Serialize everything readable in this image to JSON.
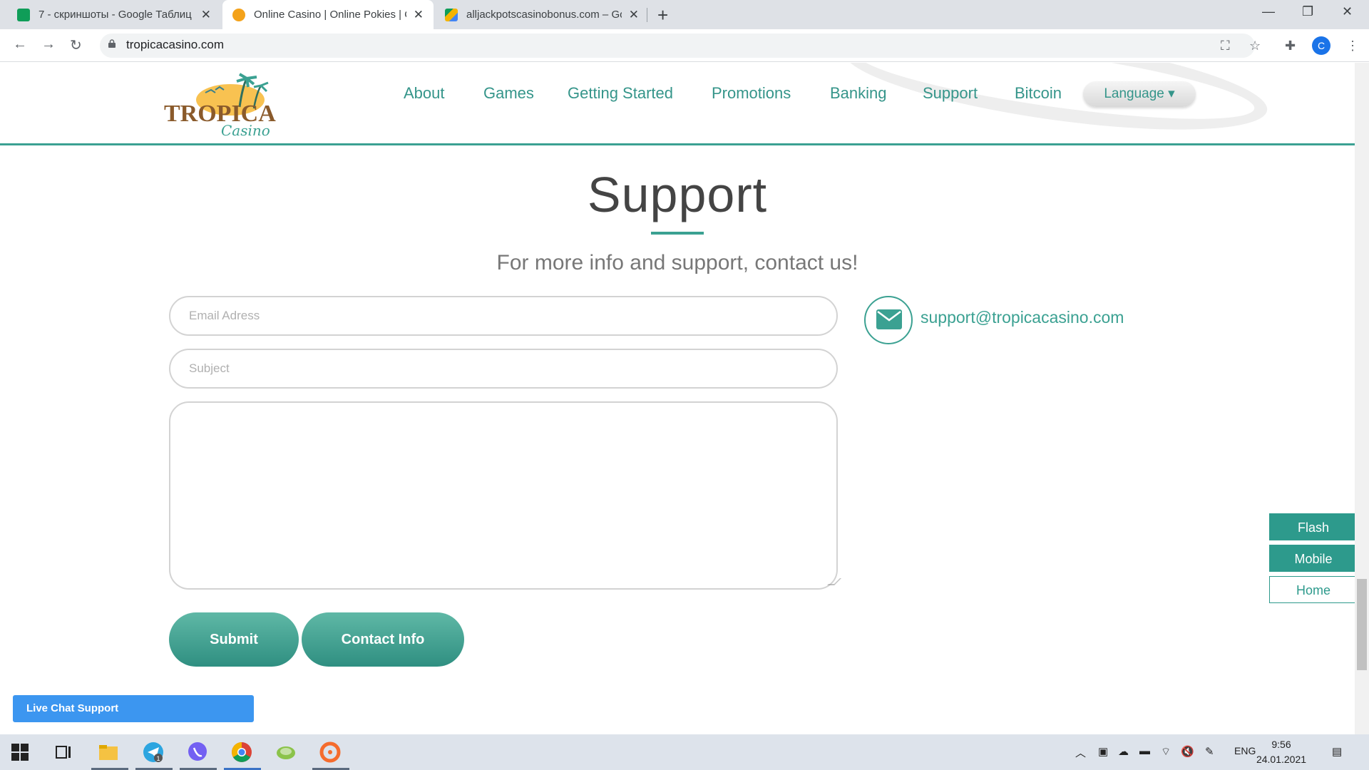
{
  "browser": {
    "tabs": [
      {
        "title": "7 - скриншоты - Google Таблиц",
        "favicon_color": "#0f9d58"
      },
      {
        "title": "Online Casino | Online Pokies | O",
        "favicon_color": "#f4a21a"
      },
      {
        "title": "alljackpotscasinobonus.com – Go",
        "favicon_color": "#4285f4"
      }
    ],
    "url": "tropicacasino.com",
    "profile_initial": "C"
  },
  "site": {
    "logo_alt": "TROPICA Casino",
    "nav": [
      "About",
      "Games",
      "Getting Started",
      "Promotions",
      "Banking",
      "Support",
      "Bitcoin"
    ],
    "language_label": "Language ▾",
    "accent_color": "#3ba192"
  },
  "support": {
    "title": "Support",
    "subtitle": "For more info and support, contact us!",
    "email_placeholder": "Email Adress",
    "subject_placeholder": "Subject",
    "message_value": "",
    "submit_label": "Submit",
    "contact_label": "Contact Info",
    "email": "support@tropicacasino.com"
  },
  "side_buttons": {
    "flash": "Flash",
    "mobile": "Mobile",
    "home": "Home"
  },
  "live_chat": "Live Chat Support",
  "taskbar": {
    "lang": "ENG",
    "time": "9:56",
    "date": "24.01.2021",
    "telegram_badge": "1"
  }
}
